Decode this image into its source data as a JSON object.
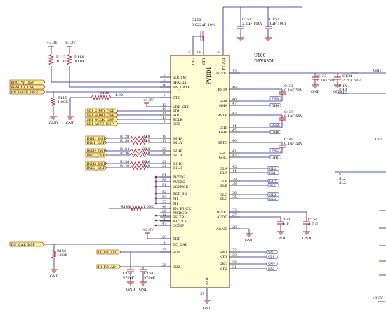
{
  "colors": {
    "wire": "#1a1aa0",
    "pin": "#202020",
    "component": "#b8141d",
    "chip_fill": "#fffdd4",
    "chip_stroke": "#8a1010",
    "netlabel_fill": "#fff48a",
    "netlabel_stroke": "#8a1010",
    "power": "#b8141d",
    "text": "#000000",
    "designator": "#1a1aa0",
    "pin_number": "#202020",
    "title": "#000000"
  },
  "chip": {
    "title": "PVDD1",
    "designator": "U100",
    "part": "DRV8301",
    "pins_left": [
      {
        "name": "nOCTW",
        "num": "5"
      },
      {
        "name": "nFAULT",
        "num": "6"
      },
      {
        "name": "EN_GATE",
        "num": "16"
      },
      {
        "name": "DTC",
        "num": "7"
      },
      {
        "name": "VDD_SPI",
        "num": "12"
      },
      {
        "name": "SDI",
        "num": "10"
      },
      {
        "name": "SDO",
        "num": "11"
      },
      {
        "name": "SCLK",
        "num": "13"
      },
      {
        "name": "SCS",
        "num": "9"
      },
      {
        "name": "INHA",
        "num": "18"
      },
      {
        "name": "INLA",
        "num": "17"
      },
      {
        "name": "INHB",
        "num": "20"
      },
      {
        "name": "INLB",
        "num": "19"
      },
      {
        "name": "INHC",
        "num": "22"
      },
      {
        "name": "INLC",
        "num": "21"
      },
      {
        "name": "PVDD2",
        "num": "54"
      },
      {
        "name": "PVDD2",
        "num": "56"
      },
      {
        "name": "VSENSE",
        "num": "51"
      },
      {
        "name": "BST_BK",
        "num": "52"
      },
      {
        "name": "PH",
        "num": "53"
      },
      {
        "name": "PH",
        "num": "55"
      },
      {
        "name": "EN_BUCK",
        "num": "49"
      },
      {
        "name": "PWRGD",
        "num": "26"
      },
      {
        "name": "SS_TR",
        "num": "41"
      },
      {
        "name": "RT_CLK",
        "num": "30"
      },
      {
        "name": "COMP",
        "num": "47"
      },
      {
        "name": "REF",
        "num": "29"
      },
      {
        "name": "DC_CAL",
        "num": "8"
      },
      {
        "name": "SO1",
        "num": "25"
      },
      {
        "name": "SO2",
        "num": "26"
      }
    ],
    "pins_right": [
      {
        "name": "GVDD",
        "num": "13"
      },
      {
        "name": "BSTA",
        "num": "48"
      },
      {
        "name": "SHA",
        "num": "46"
      },
      {
        "name": "GHA",
        "num": "47"
      },
      {
        "name": "BSTB",
        "num": "43"
      },
      {
        "name": "SHB",
        "num": "44"
      },
      {
        "name": "GHB",
        "num": "45"
      },
      {
        "name": "BSTC",
        "num": "40"
      },
      {
        "name": "SHC",
        "num": "41"
      },
      {
        "name": "GHC",
        "num": "42"
      },
      {
        "name": "GLA",
        "num": "45"
      },
      {
        "name": "SLA",
        "num": "44"
      },
      {
        "name": "GLB",
        "num": "39"
      },
      {
        "name": "SLB",
        "num": "38"
      },
      {
        "name": "GLC",
        "num": "36"
      },
      {
        "name": "SLC",
        "num": "35"
      },
      {
        "name": "DVDD",
        "num": "23"
      },
      {
        "name": "AVDD",
        "num": "27"
      },
      {
        "name": "AGND",
        "num": "28"
      },
      {
        "name": "SN1",
        "num": "32"
      },
      {
        "name": "SP1",
        "num": "33"
      },
      {
        "name": "SN2",
        "num": "30"
      },
      {
        "name": "SP2",
        "num": "31"
      }
    ],
    "pins_top": [
      {
        "name": "CP2",
        "num": "15"
      },
      {
        "name": "CP1",
        "num": "14"
      },
      {
        "name": "PVDD1",
        "num": "29"
      }
    ],
    "pins_bottom": [
      {
        "name": "PAD",
        "num": "57"
      }
    ]
  },
  "net_labels": {
    "left_top": [
      "nOCTW_DSP",
      "nFAULT_DSP",
      "EN_GATE_DSP"
    ],
    "spi": [
      "SPI_SIMO_DSP",
      "SPI_SOMI_DSP",
      "SPI_SCLK_DSP",
      "SPI_nSTE_DSP"
    ],
    "pwm": [
      "INH1_DSP",
      "INL1_DSP",
      "INH2_DSP",
      "INL2_DSP",
      "INH3_DSP",
      "INL3_DSP"
    ],
    "dc_cal": "DC_CAL_DSP",
    "isense": [
      "IA_FB_AD",
      "IB_FB_AD"
    ]
  },
  "components": {
    "r113": {
      "ref": "R113",
      "val": "10.0K"
    },
    "r114": {
      "ref": "R114",
      "val": "10.0K"
    },
    "r115": {
      "ref": "R115",
      "val": "1.00K"
    },
    "r124": {
      "ref": "R124",
      "val": "1.00"
    },
    "r_pwm": [
      {
        "ref": "R128",
        "val": "33.0"
      },
      {
        "ref": "R130",
        "val": "33.0"
      },
      {
        "ref": "R134",
        "val": "33.0"
      },
      {
        "ref": "R136",
        "val": "33.0"
      },
      {
        "ref": "R138",
        "val": "33.0"
      },
      {
        "ref": "R140",
        "val": "33.0"
      }
    ],
    "r143": {
      "ref": "R143",
      "val": "1.00K"
    },
    "r156": {
      "ref": "R156",
      "val": "1.00K"
    },
    "c150": {
      "ref": "C150",
      "val": "0.022uF 10%"
    },
    "c151": {
      "ref": "C151",
      "val": "2.2uF 100V"
    },
    "c152": {
      "ref": "C152",
      "val": "1uF 100V"
    },
    "c133": {
      "ref": "C133",
      "val": "0.1uF 50V"
    },
    "c134": {
      "ref": "C134",
      "val": "2.2uF 50V"
    },
    "c135": {
      "ref": "C135",
      "val": "0.1uF 50V"
    },
    "c139": {
      "ref": "C139",
      "val": "0.1uF 50V"
    },
    "c149": {
      "ref": "C149",
      "val": "0.1uF 50V"
    },
    "c153": {
      "ref": "C153",
      "val": "1uF"
    },
    "c154": {
      "ref": "C154",
      "val": "4.7uF"
    },
    "c157": {
      "ref": "C157",
      "val": "470pF"
    },
    "c158": {
      "ref": "C158",
      "val": "470pF"
    }
  },
  "right_nets": {
    "pha": "PHA",
    "gha": "GHA",
    "phb": "PHB",
    "ghb": "GHB",
    "phc": "PHC",
    "ghc": "GHC",
    "gl1": "GL1",
    "sl1": "SL1",
    "gl2": "GL2",
    "sl2": "SL2",
    "gl3": "GL3",
    "sl3": "SL3",
    "sn1": "SN1",
    "sp1": "SP1",
    "sn2": "SN2",
    "sp2": "SP2"
  },
  "far_right": {
    "gh1": "GH1",
    "pha": "PHA",
    "phb": "PHB",
    "phc": "PHC",
    "gl1": "GL1",
    "sl1": "SL1",
    "sl2": "SL2",
    "sl3": "SL3"
  },
  "power": {
    "v33": "+3.3V",
    "gnd": "GND"
  }
}
